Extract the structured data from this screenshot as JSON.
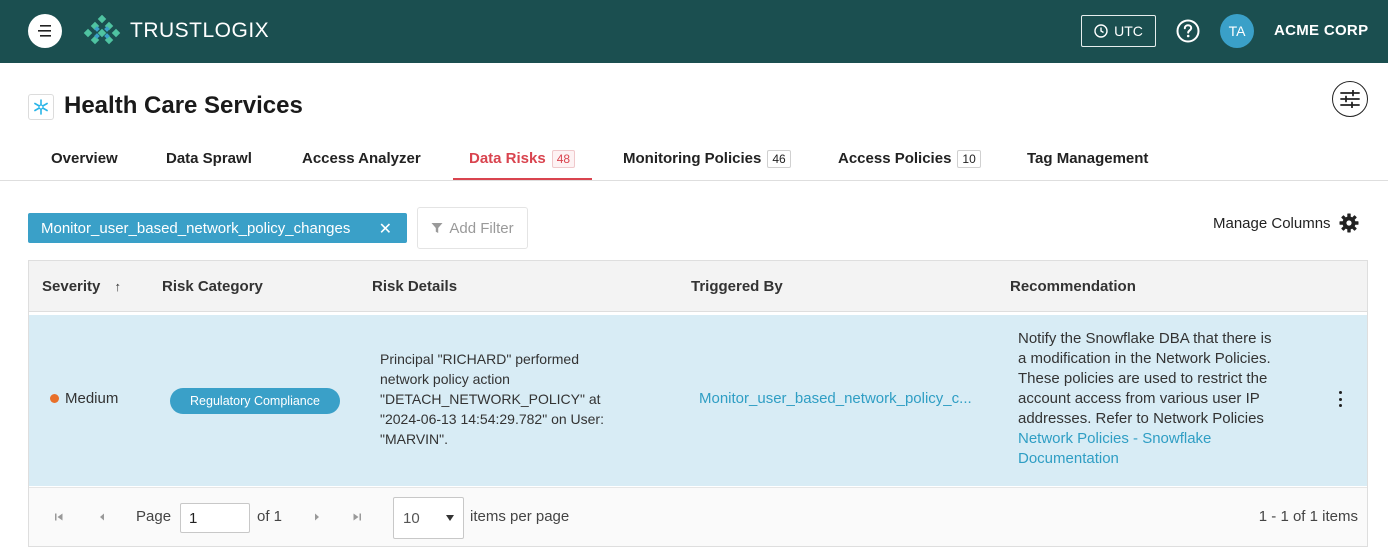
{
  "brand": {
    "name": "TRUSTLOGIX"
  },
  "header": {
    "timezone_label": "UTC",
    "avatar_initials": "TA",
    "org_name": "ACME CORP"
  },
  "page": {
    "title": "Health Care Services"
  },
  "tabs": [
    {
      "label": "Overview",
      "badge": null
    },
    {
      "label": "Data Sprawl",
      "badge": null
    },
    {
      "label": "Access Analyzer",
      "badge": null
    },
    {
      "label": "Data Risks",
      "badge": "48",
      "active": true
    },
    {
      "label": "Monitoring Policies",
      "badge": "46"
    },
    {
      "label": "Access Policies",
      "badge": "10"
    },
    {
      "label": "Tag Management",
      "badge": null
    }
  ],
  "filters": {
    "active_chip": "Monitor_user_based_network_policy_changes",
    "chip_close": "✕",
    "add_filter_label": "Add Filter",
    "manage_columns_label": "Manage Columns"
  },
  "table": {
    "columns": [
      "Severity",
      "Risk Category",
      "Risk Details",
      "Triggered By",
      "Recommendation"
    ],
    "sort_indicator": "↑",
    "rows": [
      {
        "severity": "Medium",
        "severity_color": "#e8702a",
        "risk_category": "Regulatory Compliance",
        "risk_details": [
          "Principal \"RICHARD\" performed",
          "network policy action",
          "\"DETACH_NETWORK_POLICY\" at",
          "\"2024-06-13 14:54:29.782\" on User:",
          "\"MARVIN\"."
        ],
        "triggered_by": "Monitor_user_based_network_policy_c...",
        "recommendation": [
          "Notify the Snowflake DBA that there is",
          "a modification in the Network Policies.",
          "These policies are used to restrict the",
          "account access from various user IP",
          "addresses. Refer to Network Policies"
        ],
        "recommendation_link": [
          "Network Policies - Snowflake",
          "Documentation"
        ]
      }
    ]
  },
  "pager": {
    "page_label": "Page",
    "page_value": "1",
    "of_label": "of 1",
    "page_size": "10",
    "per_page_label": "items per page",
    "summary": "1 - 1 of 1 items"
  },
  "colors": {
    "topbar": "#1b4f50",
    "accent": "#3aa0c8",
    "active_tab": "#d9444f",
    "row_highlight": "#d8ecf5"
  }
}
